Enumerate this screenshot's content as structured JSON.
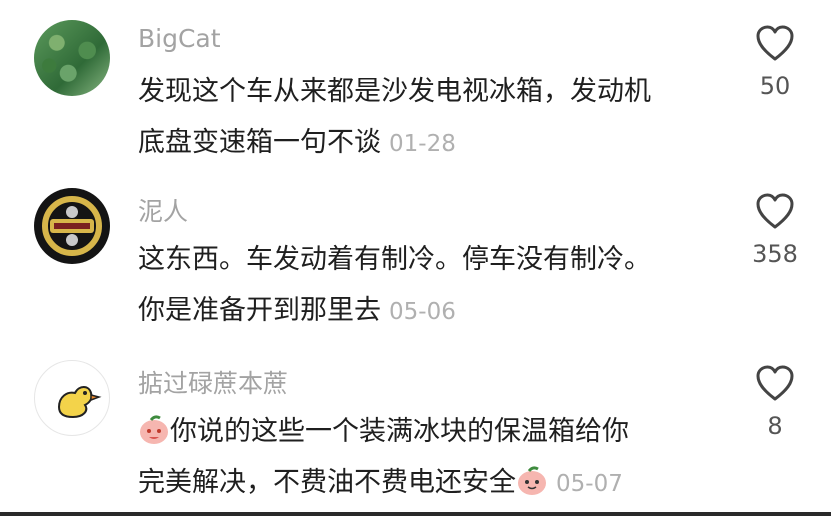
{
  "comments": [
    {
      "username": "BigCat",
      "avatar": "leaves-avatar",
      "lines": [
        "发现这个车从来都是沙发电视冰箱，发动机",
        "底盘变速箱一句不谈"
      ],
      "date": "01-28",
      "likes": "50"
    },
    {
      "username": "泥人",
      "avatar": "band-logo-avatar",
      "lines": [
        "这东西。车发动着有制冷。停车没有制冷。",
        "你是准备开到那里去"
      ],
      "date": "05-06",
      "likes": "358"
    },
    {
      "username": "掂过碌蔗本蔗",
      "avatar": "yellow-duck-avatar",
      "lines": [
        "你说的这些一个装满冰块的保温箱给你",
        "完美解决，不费油不费电还安全"
      ],
      "date": "05-07",
      "likes": "8"
    }
  ],
  "icons": {
    "like": "heart-outline-icon",
    "emoji": "peach-face-emoji"
  },
  "colors": {
    "username": "#a3a3a3",
    "text": "#1f1f1f",
    "date": "#b0b0b0",
    "count": "#555555"
  }
}
